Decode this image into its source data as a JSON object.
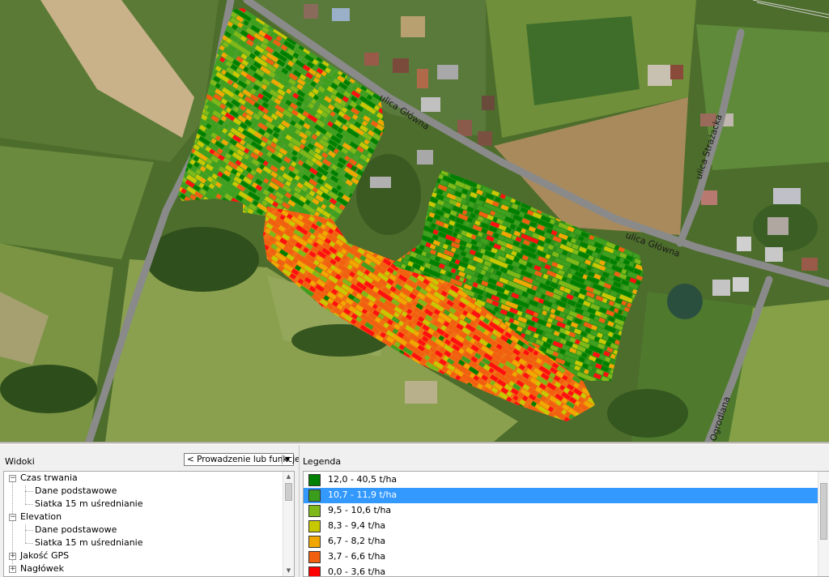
{
  "map": {
    "road_labels": [
      "ulica Główna",
      "ulica Główna",
      "ulica Strażacka",
      "Ogrodlana"
    ],
    "yield_colors": [
      "#008000",
      "#3f9f1f",
      "#7fb819",
      "#c8c800",
      "#f0a800",
      "#f06010",
      "#ff1010"
    ]
  },
  "views_panel": {
    "title": "Widoki",
    "dropdown_value": "< Prowadzenie lub funkcje >",
    "tree": [
      {
        "label": "Czas trwania",
        "level": 0,
        "expander": "−"
      },
      {
        "label": "Dane podstawowe",
        "level": 1
      },
      {
        "label": "Siatka 15 m uśrednianie",
        "level": 1
      },
      {
        "label": "Elevation",
        "level": 0,
        "expander": "−"
      },
      {
        "label": "Dane podstawowe",
        "level": 1
      },
      {
        "label": "Siatka 15 m uśrednianie",
        "level": 1
      },
      {
        "label": "Jakość GPS",
        "level": 0,
        "expander": "+"
      },
      {
        "label": "Nagłówek",
        "level": 0,
        "expander": "+"
      }
    ]
  },
  "legend_panel": {
    "title": "Legenda",
    "selected_index": 1,
    "items": [
      {
        "label": "12,0 - 40,5 t/ha",
        "color": "#008000"
      },
      {
        "label": "10,7 - 11,9 t/ha",
        "color": "#3a9e1c"
      },
      {
        "label": "9,5 - 10,6 t/ha",
        "color": "#7fb819"
      },
      {
        "label": "8,3 - 9,4 t/ha",
        "color": "#c8c800"
      },
      {
        "label": "6,7 - 8,2 t/ha",
        "color": "#f0a800"
      },
      {
        "label": "3,7 - 6,6 t/ha",
        "color": "#f06010"
      },
      {
        "label": "0,0 - 3,6 t/ha",
        "color": "#ff0000"
      }
    ]
  }
}
